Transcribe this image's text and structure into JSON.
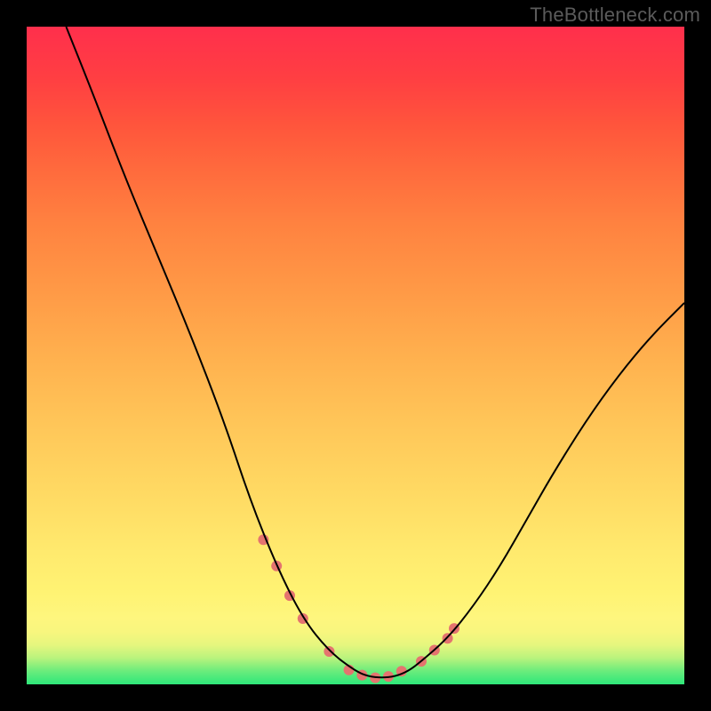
{
  "watermark": "TheBottleneck.com",
  "chart_data": {
    "type": "line",
    "title": "",
    "xlabel": "",
    "ylabel": "",
    "xlim": [
      0,
      100
    ],
    "ylim": [
      0,
      100
    ],
    "grid": false,
    "legend": false,
    "background_gradient": {
      "direction": "vertical",
      "stops": [
        {
          "pos": 0,
          "color": "#2ee77a"
        },
        {
          "pos": 10,
          "color": "#fef67e"
        },
        {
          "pos": 50,
          "color": "#ffb04e"
        },
        {
          "pos": 100,
          "color": "#ff2f4c"
        }
      ]
    },
    "series": [
      {
        "name": "curve",
        "color": "#000000",
        "stroke_width": 2,
        "x": [
          6,
          10,
          15,
          20,
          25,
          30,
          34,
          38,
          42,
          46,
          50,
          52,
          54,
          56,
          58,
          60,
          64,
          68,
          72,
          76,
          80,
          85,
          90,
          95,
          100
        ],
        "y": [
          100,
          90,
          77,
          65,
          53,
          40,
          28,
          18,
          10,
          5,
          2,
          1.2,
          1,
          1.2,
          2,
          3.5,
          7,
          12,
          18,
          25,
          32,
          40,
          47,
          53,
          58
        ]
      }
    ],
    "markers": {
      "name": "dots",
      "color": "#e4746f",
      "radius": 6,
      "x": [
        36,
        38,
        40,
        42,
        46,
        49,
        51,
        53,
        55,
        57,
        60,
        62,
        64,
        65
      ],
      "y": [
        22,
        18,
        13.5,
        10,
        5,
        2.2,
        1.4,
        1,
        1.2,
        2,
        3.5,
        5.2,
        7,
        8.5
      ]
    }
  }
}
